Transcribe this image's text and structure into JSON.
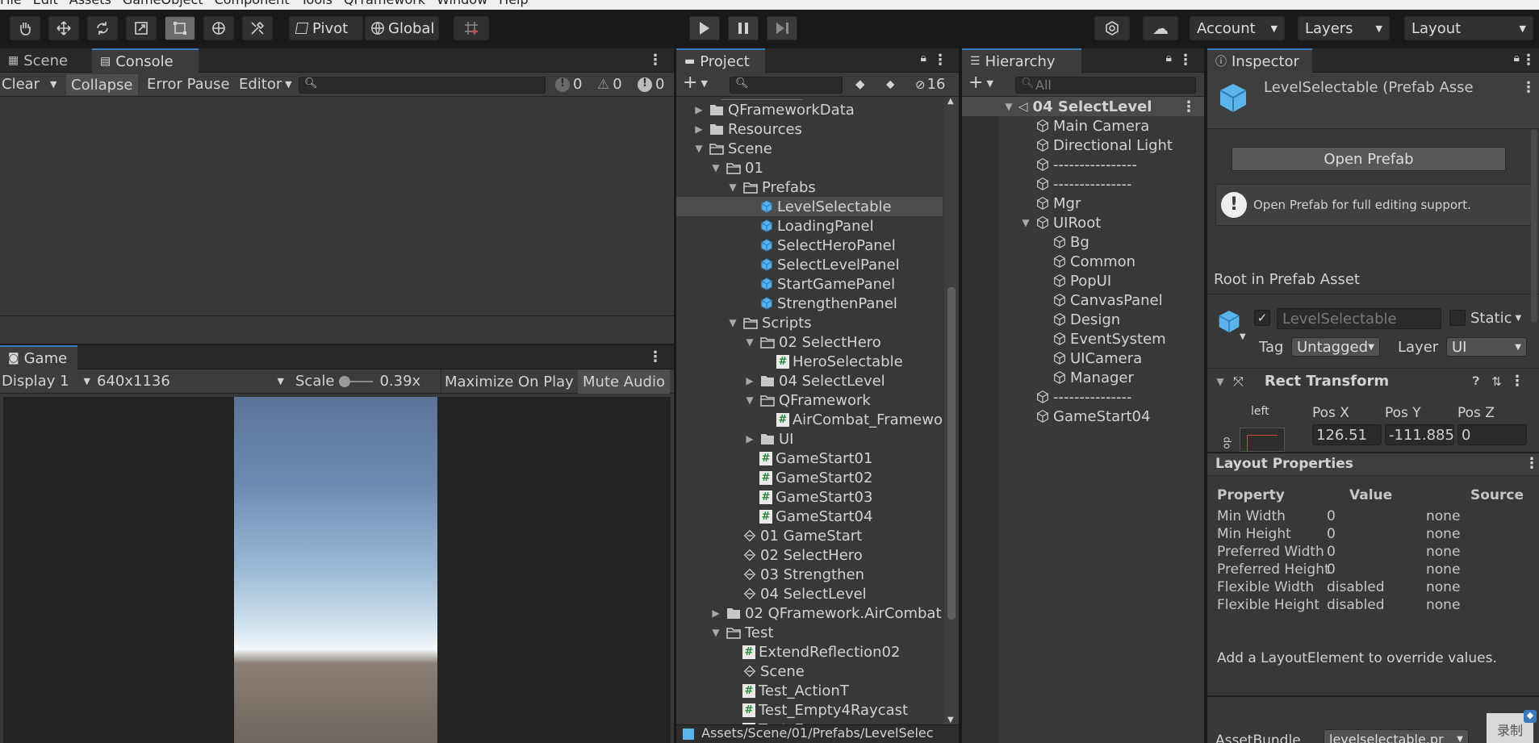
{
  "menu": [
    "File",
    "Edit",
    "Assets",
    "GameObject",
    "Component",
    "Tools",
    "QFramework",
    "Window",
    "Help"
  ],
  "toolbar": {
    "pivot_label": "Pivot",
    "global_label": "Global",
    "account_label": "Account",
    "layers_label": "Layers",
    "layout_label": "Layout"
  },
  "console": {
    "tabs": [
      "Scene",
      "Console"
    ],
    "clear": "Clear",
    "collapse": "Collapse",
    "error_pause": "Error Pause",
    "editor": "Editor",
    "search_placeholder": "",
    "count_info": "0",
    "count_warn": "0",
    "count_error": "0"
  },
  "game": {
    "tab": "Game",
    "display": "Display 1",
    "resolution": "640x1136",
    "scale_label": "Scale",
    "scale_value": "0.39x",
    "maximize": "Maximize On Play",
    "mute": "Mute Audio"
  },
  "project": {
    "tab": "Project",
    "hidden_count": "16",
    "path": "Assets/Scene/01/Prefabs/LevelSelec",
    "items": [
      {
        "label": "QFrameworkData",
        "depth": 0,
        "kind": "folder",
        "arrow": "right"
      },
      {
        "label": "Resources",
        "depth": 0,
        "kind": "folder",
        "arrow": "right"
      },
      {
        "label": "Scene",
        "depth": 0,
        "kind": "folder-open",
        "arrow": "down"
      },
      {
        "label": "01",
        "depth": 1,
        "kind": "folder-open",
        "arrow": "down"
      },
      {
        "label": "Prefabs",
        "depth": 2,
        "kind": "folder-open",
        "arrow": "down"
      },
      {
        "label": "LevelSelectable",
        "depth": 3,
        "kind": "prefab",
        "arrow": "",
        "selected": true
      },
      {
        "label": "LoadingPanel",
        "depth": 3,
        "kind": "prefab",
        "arrow": ""
      },
      {
        "label": "SelectHeroPanel",
        "depth": 3,
        "kind": "prefab",
        "arrow": ""
      },
      {
        "label": "SelectLevelPanel",
        "depth": 3,
        "kind": "prefab",
        "arrow": ""
      },
      {
        "label": "StartGamePanel",
        "depth": 3,
        "kind": "prefab",
        "arrow": ""
      },
      {
        "label": "StrengthenPanel",
        "depth": 3,
        "kind": "prefab",
        "arrow": ""
      },
      {
        "label": "Scripts",
        "depth": 2,
        "kind": "folder-open",
        "arrow": "down"
      },
      {
        "label": "02 SelectHero",
        "depth": 3,
        "kind": "folder-open",
        "arrow": "down"
      },
      {
        "label": "HeroSelectable",
        "depth": 4,
        "kind": "script",
        "arrow": ""
      },
      {
        "label": "04 SelectLevel",
        "depth": 3,
        "kind": "folder",
        "arrow": "right"
      },
      {
        "label": "QFramework",
        "depth": 3,
        "kind": "folder-open",
        "arrow": "down"
      },
      {
        "label": "AirCombat_Framewo",
        "depth": 4,
        "kind": "script",
        "arrow": ""
      },
      {
        "label": "UI",
        "depth": 3,
        "kind": "folder",
        "arrow": "right"
      },
      {
        "label": "GameStart01",
        "depth": 3,
        "kind": "script",
        "arrow": ""
      },
      {
        "label": "GameStart02",
        "depth": 3,
        "kind": "script",
        "arrow": ""
      },
      {
        "label": "GameStart03",
        "depth": 3,
        "kind": "script",
        "arrow": ""
      },
      {
        "label": "GameStart04",
        "depth": 3,
        "kind": "script",
        "arrow": ""
      },
      {
        "label": "01 GameStart",
        "depth": 2,
        "kind": "scene",
        "arrow": ""
      },
      {
        "label": "02 SelectHero",
        "depth": 2,
        "kind": "scene",
        "arrow": ""
      },
      {
        "label": "03 Strengthen",
        "depth": 2,
        "kind": "scene",
        "arrow": ""
      },
      {
        "label": "04 SelectLevel",
        "depth": 2,
        "kind": "scene",
        "arrow": ""
      },
      {
        "label": "02 QFramework.AirCombat",
        "depth": 1,
        "kind": "folder",
        "arrow": "right"
      },
      {
        "label": "Test",
        "depth": 1,
        "kind": "folder-open",
        "arrow": "down"
      },
      {
        "label": "ExtendReflection02",
        "depth": 2,
        "kind": "script",
        "arrow": ""
      },
      {
        "label": "Scene",
        "depth": 2,
        "kind": "scene",
        "arrow": ""
      },
      {
        "label": "Test_ActionT",
        "depth": 2,
        "kind": "script",
        "arrow": ""
      },
      {
        "label": "Test_Empty4Raycast",
        "depth": 2,
        "kind": "script",
        "arrow": ""
      },
      {
        "label": "Test_Enum",
        "depth": 2,
        "kind": "script",
        "arrow": ""
      }
    ]
  },
  "hierarchy": {
    "tab": "Hierarchy",
    "search_placeholder": "All",
    "root": "04 SelectLevel",
    "items": [
      {
        "label": "Main Camera",
        "depth": 1,
        "arrow": ""
      },
      {
        "label": "Directional Light",
        "depth": 1,
        "arrow": ""
      },
      {
        "label": "----------------",
        "depth": 1,
        "arrow": ""
      },
      {
        "label": "---------------",
        "depth": 1,
        "arrow": ""
      },
      {
        "label": "Mgr",
        "depth": 1,
        "arrow": ""
      },
      {
        "label": "UIRoot",
        "depth": 1,
        "arrow": "down"
      },
      {
        "label": "Bg",
        "depth": 2,
        "arrow": ""
      },
      {
        "label": "Common",
        "depth": 2,
        "arrow": ""
      },
      {
        "label": "PopUI",
        "depth": 2,
        "arrow": ""
      },
      {
        "label": "CanvasPanel",
        "depth": 2,
        "arrow": ""
      },
      {
        "label": "Design",
        "depth": 2,
        "arrow": ""
      },
      {
        "label": "EventSystem",
        "depth": 2,
        "arrow": ""
      },
      {
        "label": "UICamera",
        "depth": 2,
        "arrow": ""
      },
      {
        "label": "Manager",
        "depth": 2,
        "arrow": ""
      },
      {
        "label": "---------------",
        "depth": 1,
        "arrow": ""
      },
      {
        "label": "GameStart04",
        "depth": 1,
        "arrow": ""
      }
    ]
  },
  "inspector": {
    "tab": "Inspector",
    "title": "LevelSelectable (Prefab Asse",
    "open_prefab": "Open Prefab",
    "info": "Open Prefab for full editing support.",
    "root_label": "Root in Prefab Asset",
    "object_name": "LevelSelectable",
    "static_label": "Static",
    "tag_label": "Tag",
    "tag_value": "Untagged",
    "layer_label": "Layer",
    "layer_value": "UI",
    "rect_transform": "Rect Transform",
    "anchor_label": "left",
    "pos_x_label": "Pos X",
    "pos_y_label": "Pos Y",
    "pos_z_label": "Pos Z",
    "pos_x": "126.51",
    "pos_y": "-111.885",
    "pos_z": "0",
    "layout_props_title": "Layout Properties",
    "lp_headers": [
      "Property",
      "Value",
      "Source"
    ],
    "lp_rows": [
      [
        "Min Width",
        "0",
        "none"
      ],
      [
        "Min Height",
        "0",
        "none"
      ],
      [
        "Preferred Width",
        "0",
        "none"
      ],
      [
        "Preferred Height",
        "0",
        "none"
      ],
      [
        "Flexible Width",
        "disabled",
        "none"
      ],
      [
        "Flexible Height",
        "disabled",
        "none"
      ]
    ],
    "lp_hint": "Add a LayoutElement to override values.",
    "asset_bundle_label": "AssetBundle",
    "asset_bundle_value": "levelselectable.pr",
    "record_label": "录制"
  },
  "colors": {
    "accent": "#3a79bb",
    "prefab_blue": "#5ab3ea",
    "panel_bg": "#383838",
    "dark_bg": "#282828"
  }
}
